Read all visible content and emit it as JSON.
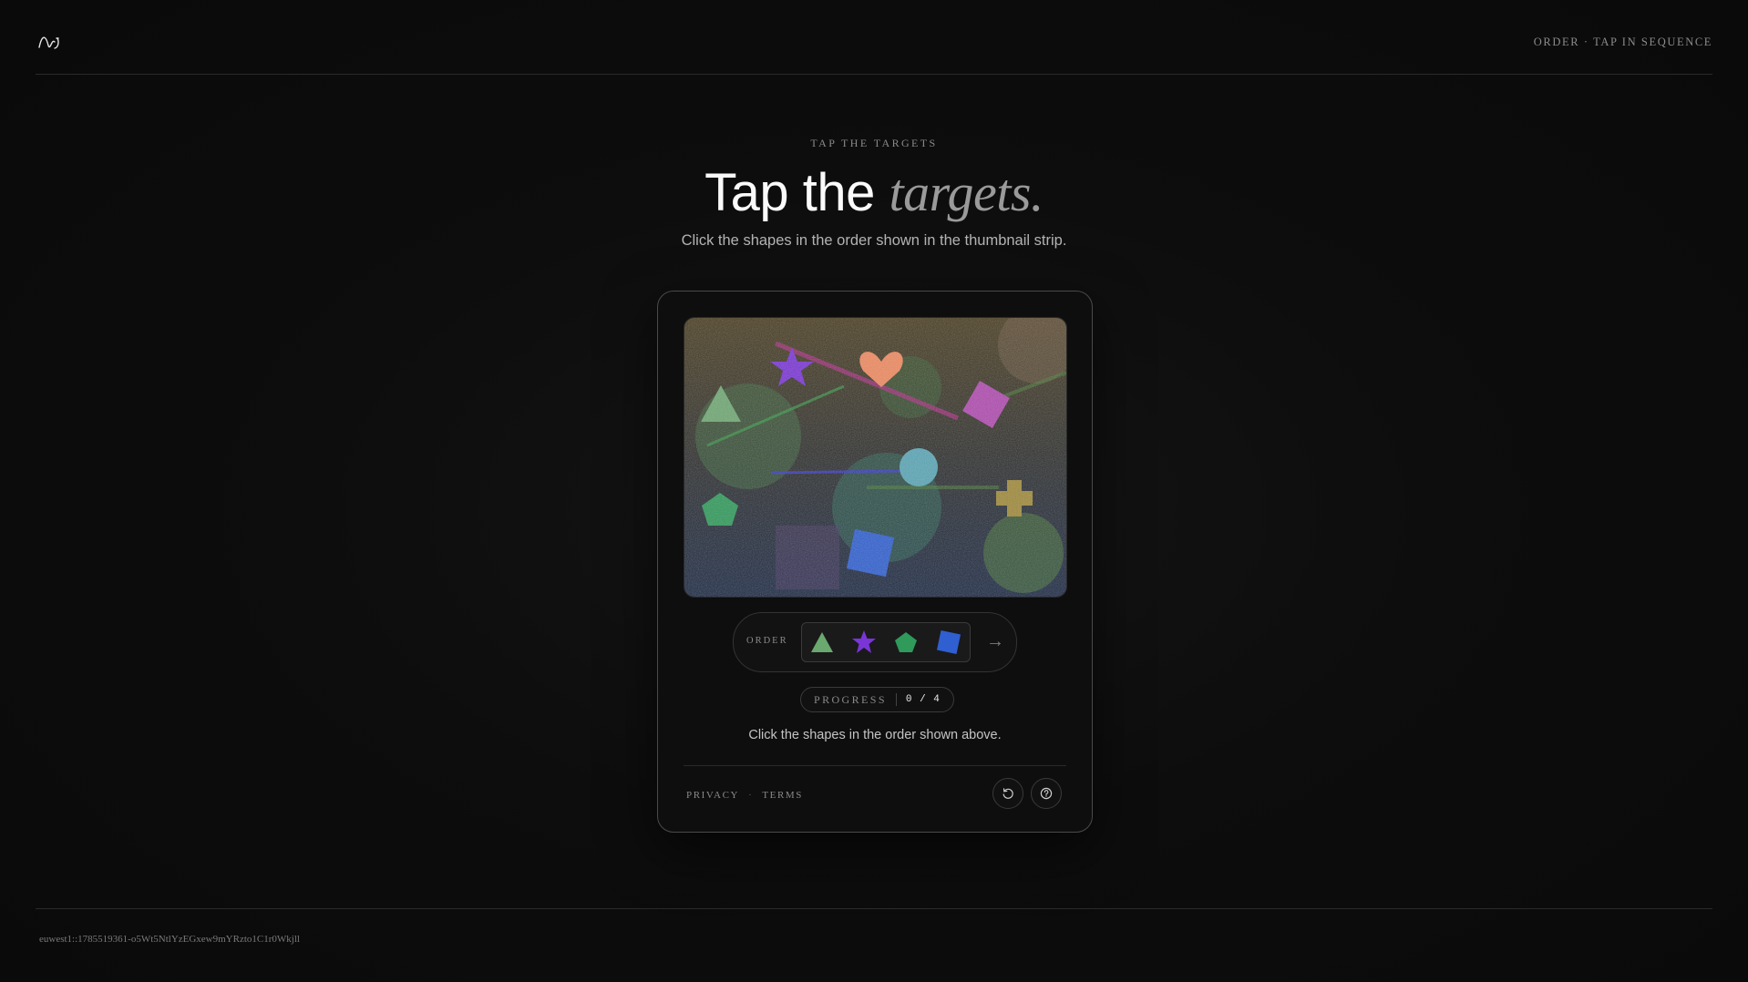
{
  "header": {
    "logo_icon": "wave-logo",
    "right_label": "ORDER · TAP IN SEQUENCE"
  },
  "hero": {
    "eyebrow": "TAP THE TARGETS",
    "title_plain": "Tap the ",
    "title_emphasis": "targets.",
    "subtitle": "Click the shapes in the order shown in the thumbnail strip."
  },
  "challenge": {
    "order_label": "ORDER",
    "order_sequence": [
      "triangle",
      "star",
      "pentagon",
      "square"
    ],
    "order_colors": [
      "#6aa86f",
      "#7a35d6",
      "#2f9a5a",
      "#2f5fd0"
    ],
    "next_icon": "arrow-right-icon",
    "next_glyph": "→",
    "progress_label": "PROGRESS",
    "progress_value": "0 / 4",
    "instruction": "Click the shapes in the order shown above."
  },
  "footer_links": {
    "privacy": "PRIVACY",
    "separator": "·",
    "terms": "TERMS",
    "refresh_icon": "refresh-icon",
    "help_icon": "help-icon"
  },
  "session_id": "euwest1::1785519361-o5Wt5NtlYzEGxew9mYRzto1C1r0Wkjll"
}
